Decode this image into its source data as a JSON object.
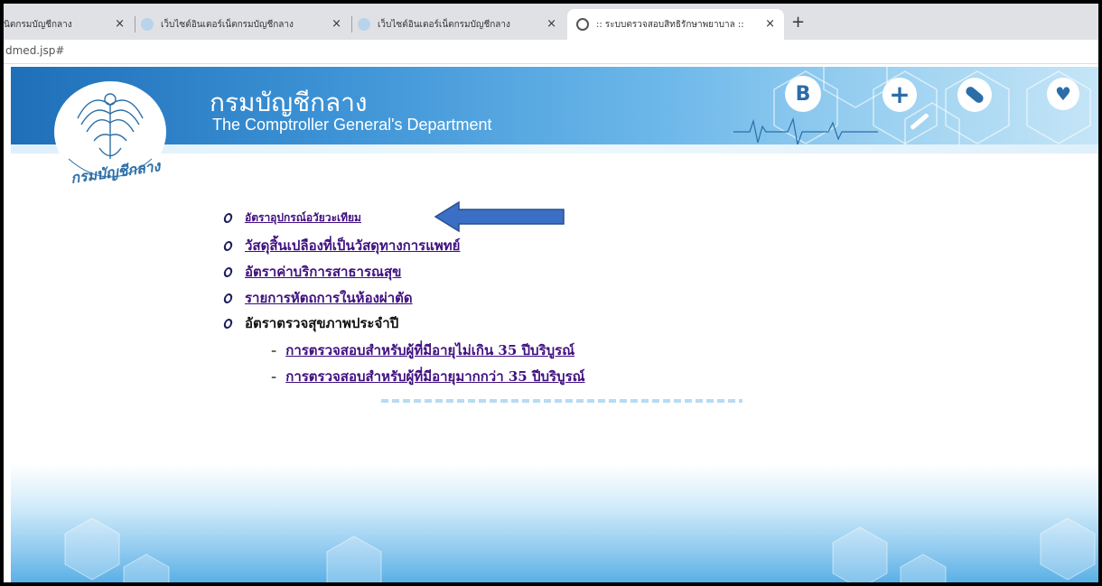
{
  "browser": {
    "tabs": [
      {
        "title": "นิตกรมบัญชีกลาง"
      },
      {
        "title": "เว็บไซต์อินเตอร์เน็ตกรมบัญชีกลาง"
      },
      {
        "title": "เว็บไซต์อินเตอร์เน็ตกรมบัญชีกลาง"
      },
      {
        "title": ":: ระบบตรวจสอบสิทธิรักษาพยาบาล ::"
      }
    ],
    "close_glyph": "×",
    "new_tab_glyph": "+",
    "url": "dmed.jsp#"
  },
  "header": {
    "title_th": "กรมบัญชีกลาง",
    "title_en": "The Comptroller General's Department",
    "logo_caption": "กรมบัญชีกลาง",
    "icons": [
      "bitcoin-icon",
      "medical-cross-icon",
      "pill-icon",
      "heart-pulse-icon",
      "syringe-icon"
    ]
  },
  "menu": {
    "items": [
      {
        "label": "อัตราอุปกรณ์อวัยวะเทียม",
        "link": true
      },
      {
        "label": "วัสดุสิ้นเปลืองที่เป็นวัสดุทางการแพทย์",
        "link": true
      },
      {
        "label": "อัตราค่าบริการสาธารณสุข",
        "link": true
      },
      {
        "label": "รายการหัตถการในห้องผ่าตัด",
        "link": true
      },
      {
        "label": "อัตราตรวจสุขภาพประจำปี",
        "link": false
      }
    ],
    "sub_items": [
      {
        "dash": "-",
        "label": "การตรวจสอบสำหรับผู้ที่มีอายุไม่เกิน 35 ปีบริบูรณ์"
      },
      {
        "dash": "-",
        "label": "การตรวจสอบสำหรับผู้ที่มีอายุมากกว่า 35 ปีบริบูรณ์"
      }
    ]
  },
  "colors": {
    "header_blue": "#1e6fb8",
    "link_purple": "#401080",
    "arrow_blue": "#3b6fc6"
  }
}
